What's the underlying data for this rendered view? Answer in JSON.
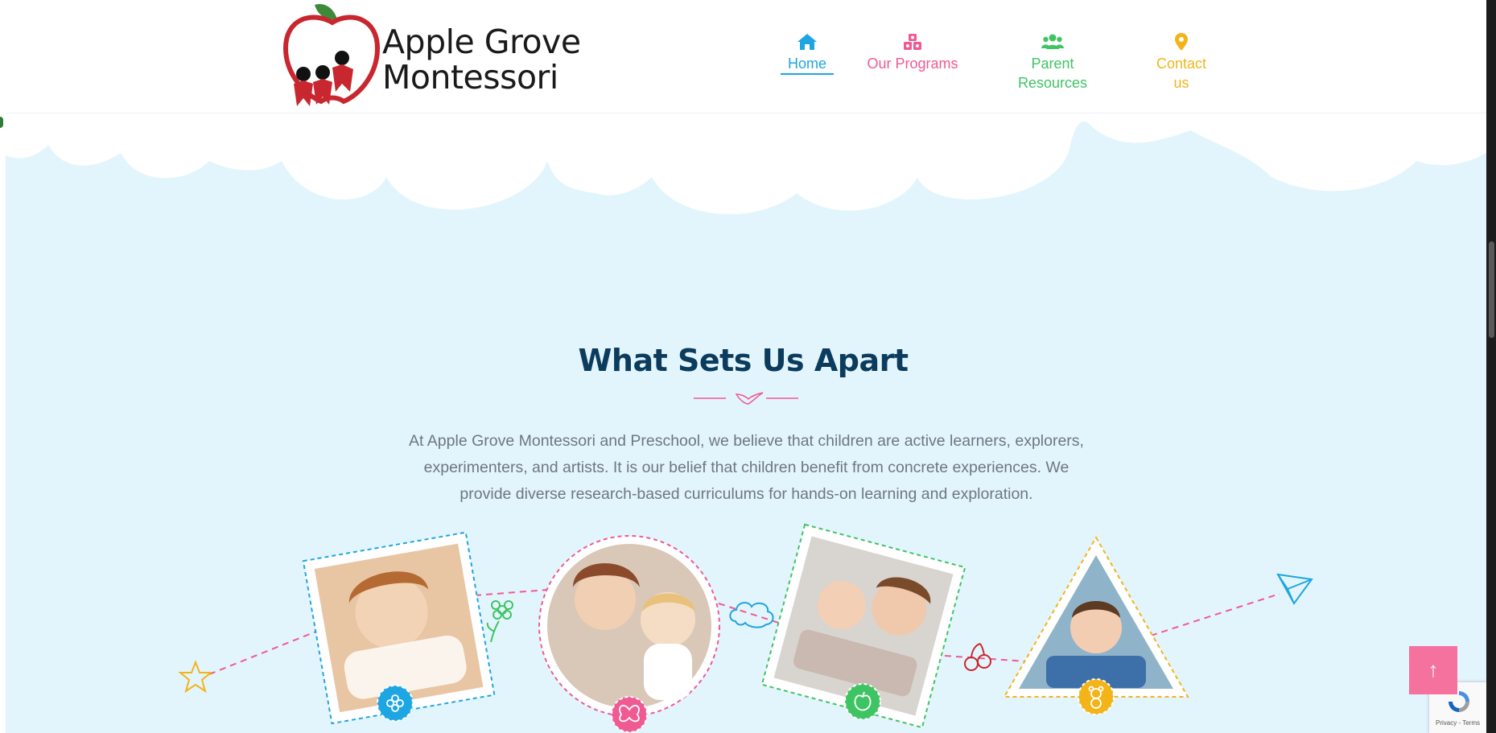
{
  "brand": {
    "name_line1": "Apple Grove",
    "name_line2": "Montessori"
  },
  "nav": [
    {
      "label": "Home",
      "icon": "home-icon",
      "color": "#1ea6e3",
      "active": true
    },
    {
      "label": "Our Programs",
      "icon": "blocks-icon",
      "color": "#ef5a93"
    },
    {
      "label": "Parent Resources",
      "icon": "users-icon",
      "color": "#3fc463"
    },
    {
      "label": "Contact us",
      "icon": "map-pin-icon",
      "color": "#f3b41a"
    }
  ],
  "section": {
    "title": "What Sets Us Apart",
    "intro": "At Apple Grove Montessori and Preschool, we believe that children are active learners, explorers, experimenters, and artists. It is our belief that children benefit from concrete experiences. We provide diverse research-based curriculums for hands-on learning and exploration."
  },
  "features": [
    {
      "photo": "child-eating-photo",
      "badge_icon": "flower-icon",
      "color": "#1ea6e3"
    },
    {
      "photo": "mother-and-child-photo",
      "badge_icon": "butterfly-icon",
      "color": "#ef5a93"
    },
    {
      "photo": "children-playing-photo",
      "badge_icon": "apple-icon",
      "color": "#3fc463"
    },
    {
      "photo": "boy-smiling-photo",
      "badge_icon": "teddy-bear-icon",
      "color": "#f3b41a"
    }
  ],
  "back_to_top": {
    "label": "↑"
  },
  "recaptcha": {
    "text": "Privacy - Terms"
  },
  "colors": {
    "background": "#e3f5fc",
    "title": "#0b3c5d",
    "accent_pink": "#ef5a93",
    "accent_blue": "#1ea6e3",
    "accent_green": "#3fc463",
    "accent_yellow": "#f3b41a"
  }
}
